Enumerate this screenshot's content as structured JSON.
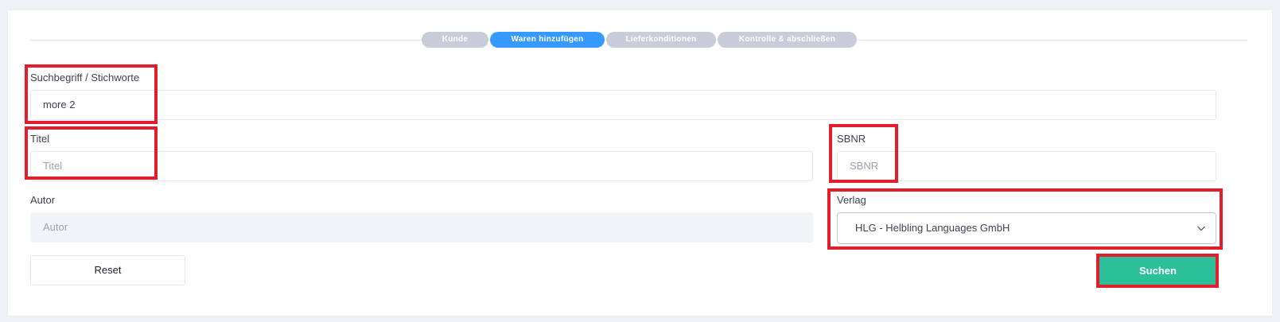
{
  "stepper": {
    "steps": [
      {
        "label": "Kunde",
        "active": false
      },
      {
        "label": "Waren hinzufügen",
        "active": true
      },
      {
        "label": "Lieferkonditionen",
        "active": false
      },
      {
        "label": "Kontrolle & abschließen",
        "active": false
      }
    ]
  },
  "form": {
    "search": {
      "label": "Suchbegriff / Stichworte",
      "value": "more 2"
    },
    "title": {
      "label": "Titel",
      "placeholder": "Titel"
    },
    "sbnr": {
      "label": "SBNR",
      "placeholder": "SBNR"
    },
    "author": {
      "label": "Autor",
      "placeholder": "Autor"
    },
    "publisher": {
      "label": "Verlag",
      "selected": "HLG - Helbling Languages GmbH"
    }
  },
  "actions": {
    "reset_label": "Reset",
    "search_label": "Suchen"
  },
  "colors": {
    "accent": "#3699ff",
    "search_button": "#2bbf9a",
    "highlight": "#e21d2c",
    "step_inactive": "#c9ccd9"
  }
}
